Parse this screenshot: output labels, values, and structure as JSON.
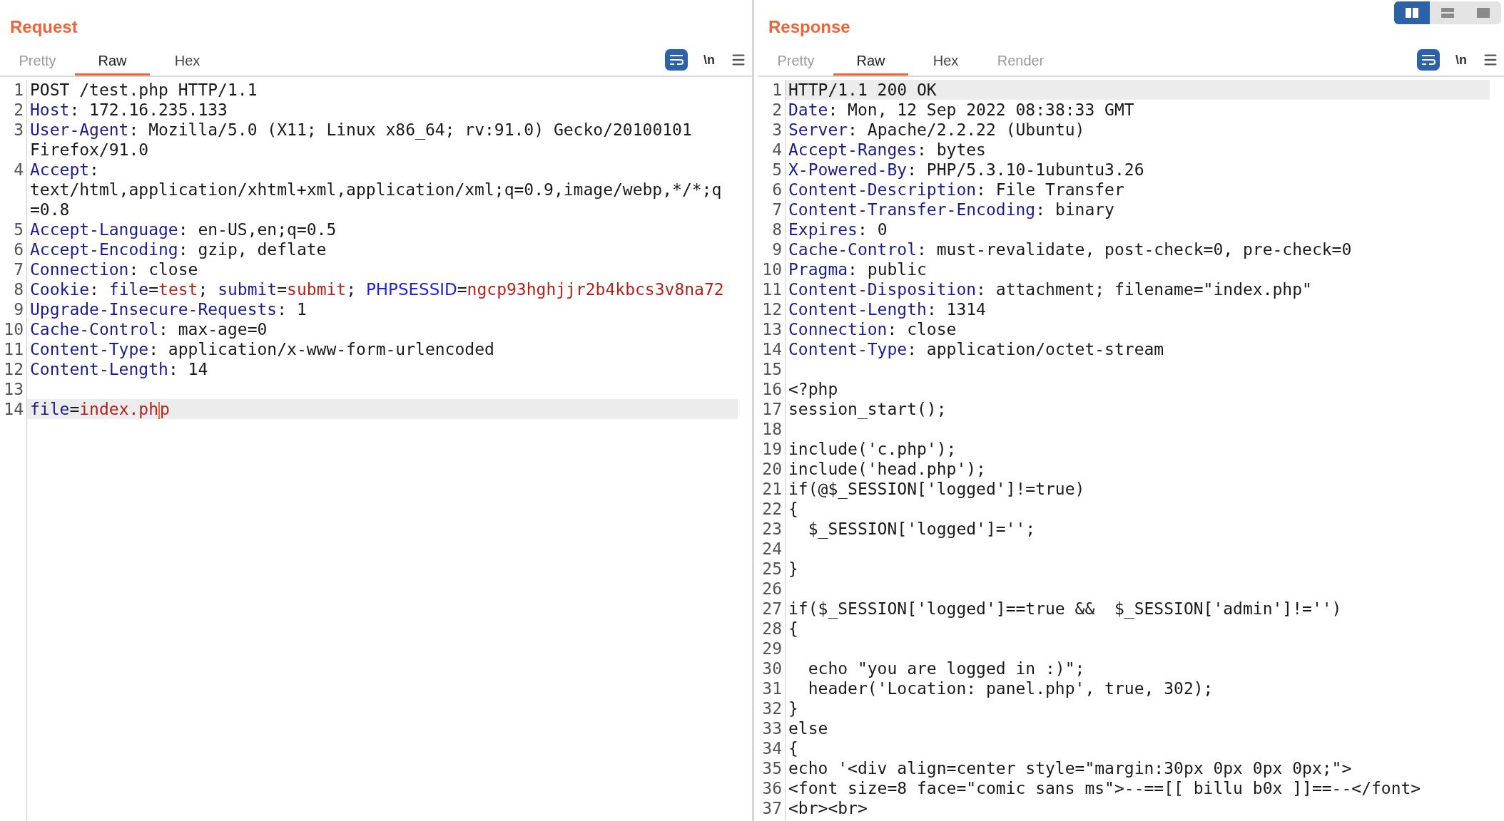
{
  "view_toggle": [
    {
      "kind": "columns",
      "selected": true
    },
    {
      "kind": "rows",
      "selected": false
    },
    {
      "kind": "single",
      "selected": false
    }
  ],
  "panels": [
    {
      "title": "Request",
      "tabs": [
        {
          "label": "Pretty",
          "selected": false,
          "disabled": true
        },
        {
          "label": "Raw",
          "selected": true,
          "disabled": false
        },
        {
          "label": "Hex",
          "selected": false,
          "disabled": false
        }
      ],
      "toolbar": {
        "newline_label": "\\n"
      },
      "lines": [
        {
          "number": "1",
          "highlighted": false,
          "tokens": [
            {
              "kind": "text",
              "text": "POST /test.php HTTP/1.1"
            }
          ]
        },
        {
          "number": "2",
          "highlighted": false,
          "tokens": [
            {
              "kind": "name",
              "text": "Host"
            },
            {
              "kind": "text",
              "text": ": 172.16.235.133"
            }
          ]
        },
        {
          "number": "3",
          "highlighted": false,
          "tokens": [
            {
              "kind": "name",
              "text": "User-Agent"
            },
            {
              "kind": "text",
              "text": ": Mozilla/5.0 (X11; Linux x86_64; rv:91.0) Gecko/20100101"
            },
            {
              "kind": "break"
            },
            {
              "kind": "text",
              "text": "Firefox/91.0"
            }
          ]
        },
        {
          "number": "4",
          "highlighted": false,
          "tokens": [
            {
              "kind": "name",
              "text": "Accept"
            },
            {
              "kind": "text",
              "text": ":"
            },
            {
              "kind": "break"
            },
            {
              "kind": "text",
              "text": "text/html,application/xhtml+xml,application/xml;q=0.9,image/webp,*/*;q"
            },
            {
              "kind": "break"
            },
            {
              "kind": "text",
              "text": "=0.8"
            }
          ]
        },
        {
          "number": "5",
          "highlighted": false,
          "tokens": [
            {
              "kind": "name",
              "text": "Accept-Language"
            },
            {
              "kind": "text",
              "text": ": en-US,en;q=0.5"
            }
          ]
        },
        {
          "number": "6",
          "highlighted": false,
          "tokens": [
            {
              "kind": "name",
              "text": "Accept-Encoding"
            },
            {
              "kind": "text",
              "text": ": gzip, deflate"
            }
          ]
        },
        {
          "number": "7",
          "highlighted": false,
          "tokens": [
            {
              "kind": "name",
              "text": "Connection"
            },
            {
              "kind": "text",
              "text": ": close"
            }
          ]
        },
        {
          "number": "8",
          "highlighted": false,
          "tokens": [
            {
              "kind": "name",
              "text": "Cookie"
            },
            {
              "kind": "text",
              "text": ": "
            },
            {
              "kind": "name",
              "text": "file"
            },
            {
              "kind": "text",
              "text": "="
            },
            {
              "kind": "value",
              "text": "test"
            },
            {
              "kind": "text",
              "text": "; "
            },
            {
              "kind": "name",
              "text": "submit"
            },
            {
              "kind": "text",
              "text": "="
            },
            {
              "kind": "value",
              "text": "submit"
            },
            {
              "kind": "text",
              "text": "; "
            },
            {
              "kind": "param",
              "text": "PHPSESSID"
            },
            {
              "kind": "text",
              "text": "="
            },
            {
              "kind": "value",
              "text": "ngcp93hghjjr2b4kbcs3v8na72"
            }
          ]
        },
        {
          "number": "9",
          "highlighted": false,
          "tokens": [
            {
              "kind": "name",
              "text": "Upgrade-Insecure-Requests"
            },
            {
              "kind": "text",
              "text": ": 1"
            }
          ]
        },
        {
          "number": "10",
          "highlighted": false,
          "tokens": [
            {
              "kind": "name",
              "text": "Cache-Control"
            },
            {
              "kind": "text",
              "text": ": max-age=0"
            }
          ]
        },
        {
          "number": "11",
          "highlighted": false,
          "tokens": [
            {
              "kind": "name",
              "text": "Content-Type"
            },
            {
              "kind": "text",
              "text": ": application/x-www-form-urlencoded"
            }
          ]
        },
        {
          "number": "12",
          "highlighted": false,
          "tokens": [
            {
              "kind": "name",
              "text": "Content-Length"
            },
            {
              "kind": "text",
              "text": ": 14"
            }
          ]
        },
        {
          "number": "13",
          "highlighted": false
        },
        {
          "number": "14",
          "highlighted": true,
          "tokens": [
            {
              "kind": "name",
              "text": "file"
            },
            {
              "kind": "text",
              "text": "="
            },
            {
              "kind": "value",
              "text": "index.ph"
            },
            {
              "kind": "cursor"
            },
            {
              "kind": "value",
              "text": "p"
            }
          ]
        }
      ]
    },
    {
      "title": "Response",
      "tabs": [
        {
          "label": "Pretty",
          "selected": false,
          "disabled": true
        },
        {
          "label": "Raw",
          "selected": true,
          "disabled": false
        },
        {
          "label": "Hex",
          "selected": false,
          "disabled": false
        },
        {
          "label": "Render",
          "selected": false,
          "disabled": true
        }
      ],
      "toolbar": {
        "newline_label": "\\n"
      },
      "lines": [
        {
          "number": "1",
          "highlighted": true,
          "tokens": [
            {
              "kind": "text",
              "text": "HTTP/1.1 200 OK"
            }
          ]
        },
        {
          "number": "2",
          "highlighted": false,
          "tokens": [
            {
              "kind": "name",
              "text": "Date"
            },
            {
              "kind": "text",
              "text": ": Mon, 12 Sep 2022 08:38:33 GMT"
            }
          ]
        },
        {
          "number": "3",
          "highlighted": false,
          "tokens": [
            {
              "kind": "name",
              "text": "Server"
            },
            {
              "kind": "text",
              "text": ": Apache/2.2.22 (Ubuntu)"
            }
          ]
        },
        {
          "number": "4",
          "highlighted": false,
          "tokens": [
            {
              "kind": "name",
              "text": "Accept-Ranges"
            },
            {
              "kind": "text",
              "text": ": bytes"
            }
          ]
        },
        {
          "number": "5",
          "highlighted": false,
          "tokens": [
            {
              "kind": "name",
              "text": "X-Powered-By"
            },
            {
              "kind": "text",
              "text": ": PHP/5.3.10-1ubuntu3.26"
            }
          ]
        },
        {
          "number": "6",
          "highlighted": false,
          "tokens": [
            {
              "kind": "name",
              "text": "Content-Description"
            },
            {
              "kind": "text",
              "text": ": File Transfer"
            }
          ]
        },
        {
          "number": "7",
          "highlighted": false,
          "tokens": [
            {
              "kind": "name",
              "text": "Content-Transfer-Encoding"
            },
            {
              "kind": "text",
              "text": ": binary"
            }
          ]
        },
        {
          "number": "8",
          "highlighted": false,
          "tokens": [
            {
              "kind": "name",
              "text": "Expires"
            },
            {
              "kind": "text",
              "text": ": 0"
            }
          ]
        },
        {
          "number": "9",
          "highlighted": false,
          "tokens": [
            {
              "kind": "name",
              "text": "Cache-Control"
            },
            {
              "kind": "text",
              "text": ": must-revalidate, post-check=0, pre-check=0"
            }
          ]
        },
        {
          "number": "10",
          "highlighted": false,
          "tokens": [
            {
              "kind": "name",
              "text": "Pragma"
            },
            {
              "kind": "text",
              "text": ": public"
            }
          ]
        },
        {
          "number": "11",
          "highlighted": false,
          "tokens": [
            {
              "kind": "name",
              "text": "Content-Disposition"
            },
            {
              "kind": "text",
              "text": ": attachment; filename=\"index.php\""
            }
          ]
        },
        {
          "number": "12",
          "highlighted": false,
          "tokens": [
            {
              "kind": "name",
              "text": "Content-Length"
            },
            {
              "kind": "text",
              "text": ": 1314"
            }
          ]
        },
        {
          "number": "13",
          "highlighted": false,
          "tokens": [
            {
              "kind": "name",
              "text": "Connection"
            },
            {
              "kind": "text",
              "text": ": close"
            }
          ]
        },
        {
          "number": "14",
          "highlighted": false,
          "tokens": [
            {
              "kind": "name",
              "text": "Content-Type"
            },
            {
              "kind": "text",
              "text": ": application/octet-stream"
            }
          ]
        },
        {
          "number": "15",
          "highlighted": false
        },
        {
          "number": "16",
          "highlighted": false,
          "tokens": [
            {
              "kind": "text",
              "text": "<?php"
            }
          ]
        },
        {
          "number": "17",
          "highlighted": false,
          "tokens": [
            {
              "kind": "text",
              "text": "session_start();"
            }
          ]
        },
        {
          "number": "18",
          "highlighted": false
        },
        {
          "number": "19",
          "highlighted": false,
          "tokens": [
            {
              "kind": "text",
              "text": "include('c.php');"
            }
          ]
        },
        {
          "number": "20",
          "highlighted": false,
          "tokens": [
            {
              "kind": "text",
              "text": "include('head.php');"
            }
          ]
        },
        {
          "number": "21",
          "highlighted": false,
          "tokens": [
            {
              "kind": "text",
              "text": "if(@$_SESSION['logged']!=true)"
            }
          ]
        },
        {
          "number": "22",
          "highlighted": false,
          "tokens": [
            {
              "kind": "text",
              "text": "{"
            }
          ]
        },
        {
          "number": "23",
          "highlighted": false,
          "tokens": [
            {
              "kind": "text",
              "text": "  $_SESSION['logged']='';"
            }
          ]
        },
        {
          "number": "24",
          "highlighted": false
        },
        {
          "number": "25",
          "highlighted": false,
          "tokens": [
            {
              "kind": "text",
              "text": "}"
            }
          ]
        },
        {
          "number": "26",
          "highlighted": false
        },
        {
          "number": "27",
          "highlighted": false,
          "tokens": [
            {
              "kind": "text",
              "text": "if($_SESSION['logged']==true &&  $_SESSION['admin']!='')"
            }
          ]
        },
        {
          "number": "28",
          "highlighted": false,
          "tokens": [
            {
              "kind": "text",
              "text": "{"
            }
          ]
        },
        {
          "number": "29",
          "highlighted": false
        },
        {
          "number": "30",
          "highlighted": false,
          "tokens": [
            {
              "kind": "text",
              "text": "  echo \"you are logged in :)\";"
            }
          ]
        },
        {
          "number": "31",
          "highlighted": false,
          "tokens": [
            {
              "kind": "text",
              "text": "  header('Location: panel.php', true, 302);"
            }
          ]
        },
        {
          "number": "32",
          "highlighted": false,
          "tokens": [
            {
              "kind": "text",
              "text": "}"
            }
          ]
        },
        {
          "number": "33",
          "highlighted": false,
          "tokens": [
            {
              "kind": "text",
              "text": "else"
            }
          ]
        },
        {
          "number": "34",
          "highlighted": false,
          "tokens": [
            {
              "kind": "text",
              "text": "{"
            }
          ]
        },
        {
          "number": "35",
          "highlighted": false,
          "tokens": [
            {
              "kind": "text",
              "text": "echo '<div align=center style=\"margin:30px 0px 0px 0px;\">"
            }
          ]
        },
        {
          "number": "36",
          "highlighted": false,
          "tokens": [
            {
              "kind": "text",
              "text": "<font size=8 face=\"comic sans ms\">--==[[ billu b0x ]]==--</font>"
            }
          ]
        },
        {
          "number": "37",
          "highlighted": false,
          "tokens": [
            {
              "kind": "text",
              "text": "<br><br>"
            }
          ]
        }
      ]
    }
  ]
}
